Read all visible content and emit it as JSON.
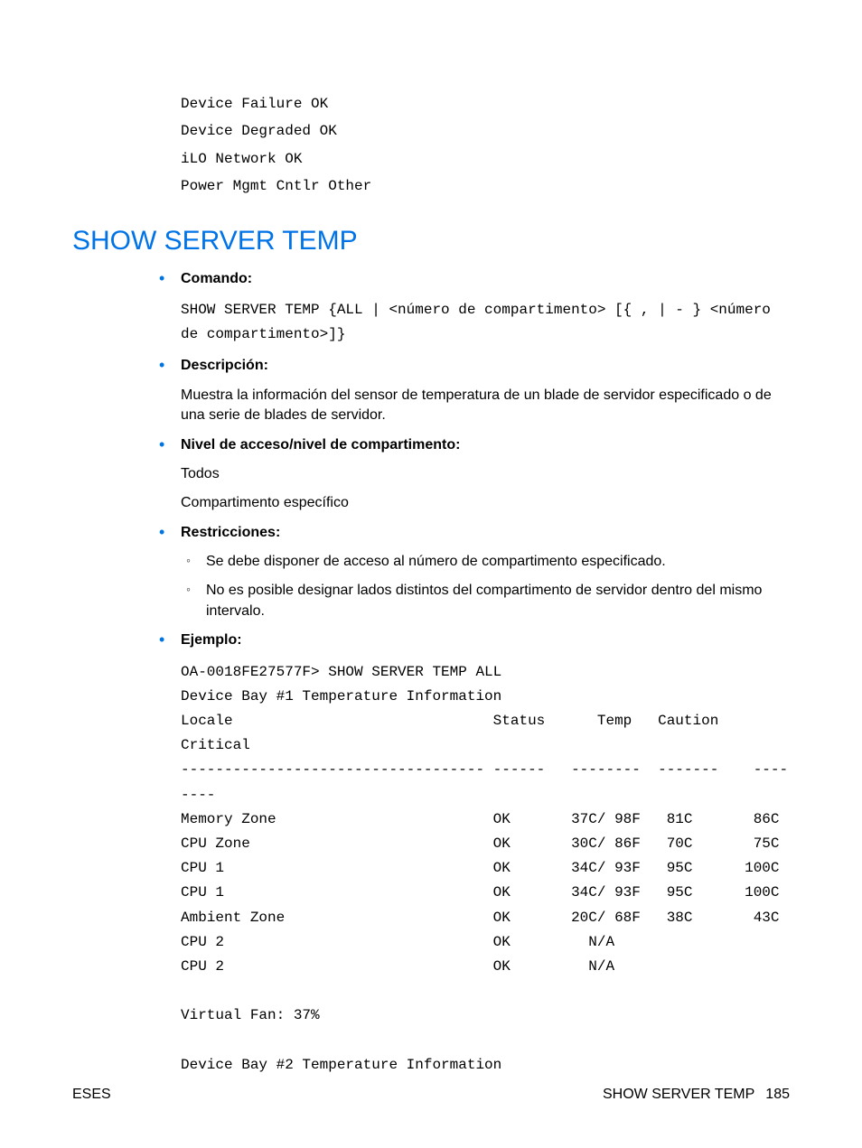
{
  "pre_status_lines": [
    "Device Failure OK",
    "Device Degraded OK",
    "iLO Network OK",
    "Power Mgmt Cntlr Other"
  ],
  "heading": "SHOW SERVER TEMP",
  "items": {
    "comando": {
      "label": "Comando:",
      "text": "SHOW SERVER TEMP {ALL | <número de compartimento> [{ , | - } <número de compartimento>]}"
    },
    "descripcion": {
      "label": "Descripción:",
      "text": "Muestra la información del sensor de temperatura de un blade de servidor especificado o de una serie de blades de servidor."
    },
    "nivel": {
      "label": "Nivel de acceso/nivel de compartimento:",
      "line1": "Todos",
      "line2": "Compartimento específico"
    },
    "restricciones": {
      "label": "Restricciones:",
      "sub": [
        "Se debe disponer de acceso al número de compartimento especificado.",
        "No es posible designar lados distintos del compartimento de servidor dentro del mismo intervalo."
      ]
    },
    "ejemplo": {
      "label": "Ejemplo:",
      "lines": [
        "OA-0018FE27577F> SHOW SERVER TEMP ALL",
        "Device Bay #1 Temperature Information",
        "Locale                              Status      Temp   Caution   Critical",
        "----------------------------------- ------   --------  -------    --------",
        "Memory Zone                         OK       37C/ 98F   81C       86C",
        "CPU Zone                            OK       30C/ 86F   70C       75C",
        "CPU 1                               OK       34C/ 93F   95C      100C",
        "CPU 1                               OK       34C/ 93F   95C      100C",
        "Ambient Zone                        OK       20C/ 68F   38C       43C",
        "CPU 2                               OK         N/A",
        "CPU 2                               OK         N/A",
        "",
        "Virtual Fan: 37%",
        "",
        "Device Bay #2 Temperature Information"
      ]
    }
  },
  "footer": {
    "left": "ESES",
    "right_label": "SHOW SERVER TEMP",
    "page": "185"
  }
}
